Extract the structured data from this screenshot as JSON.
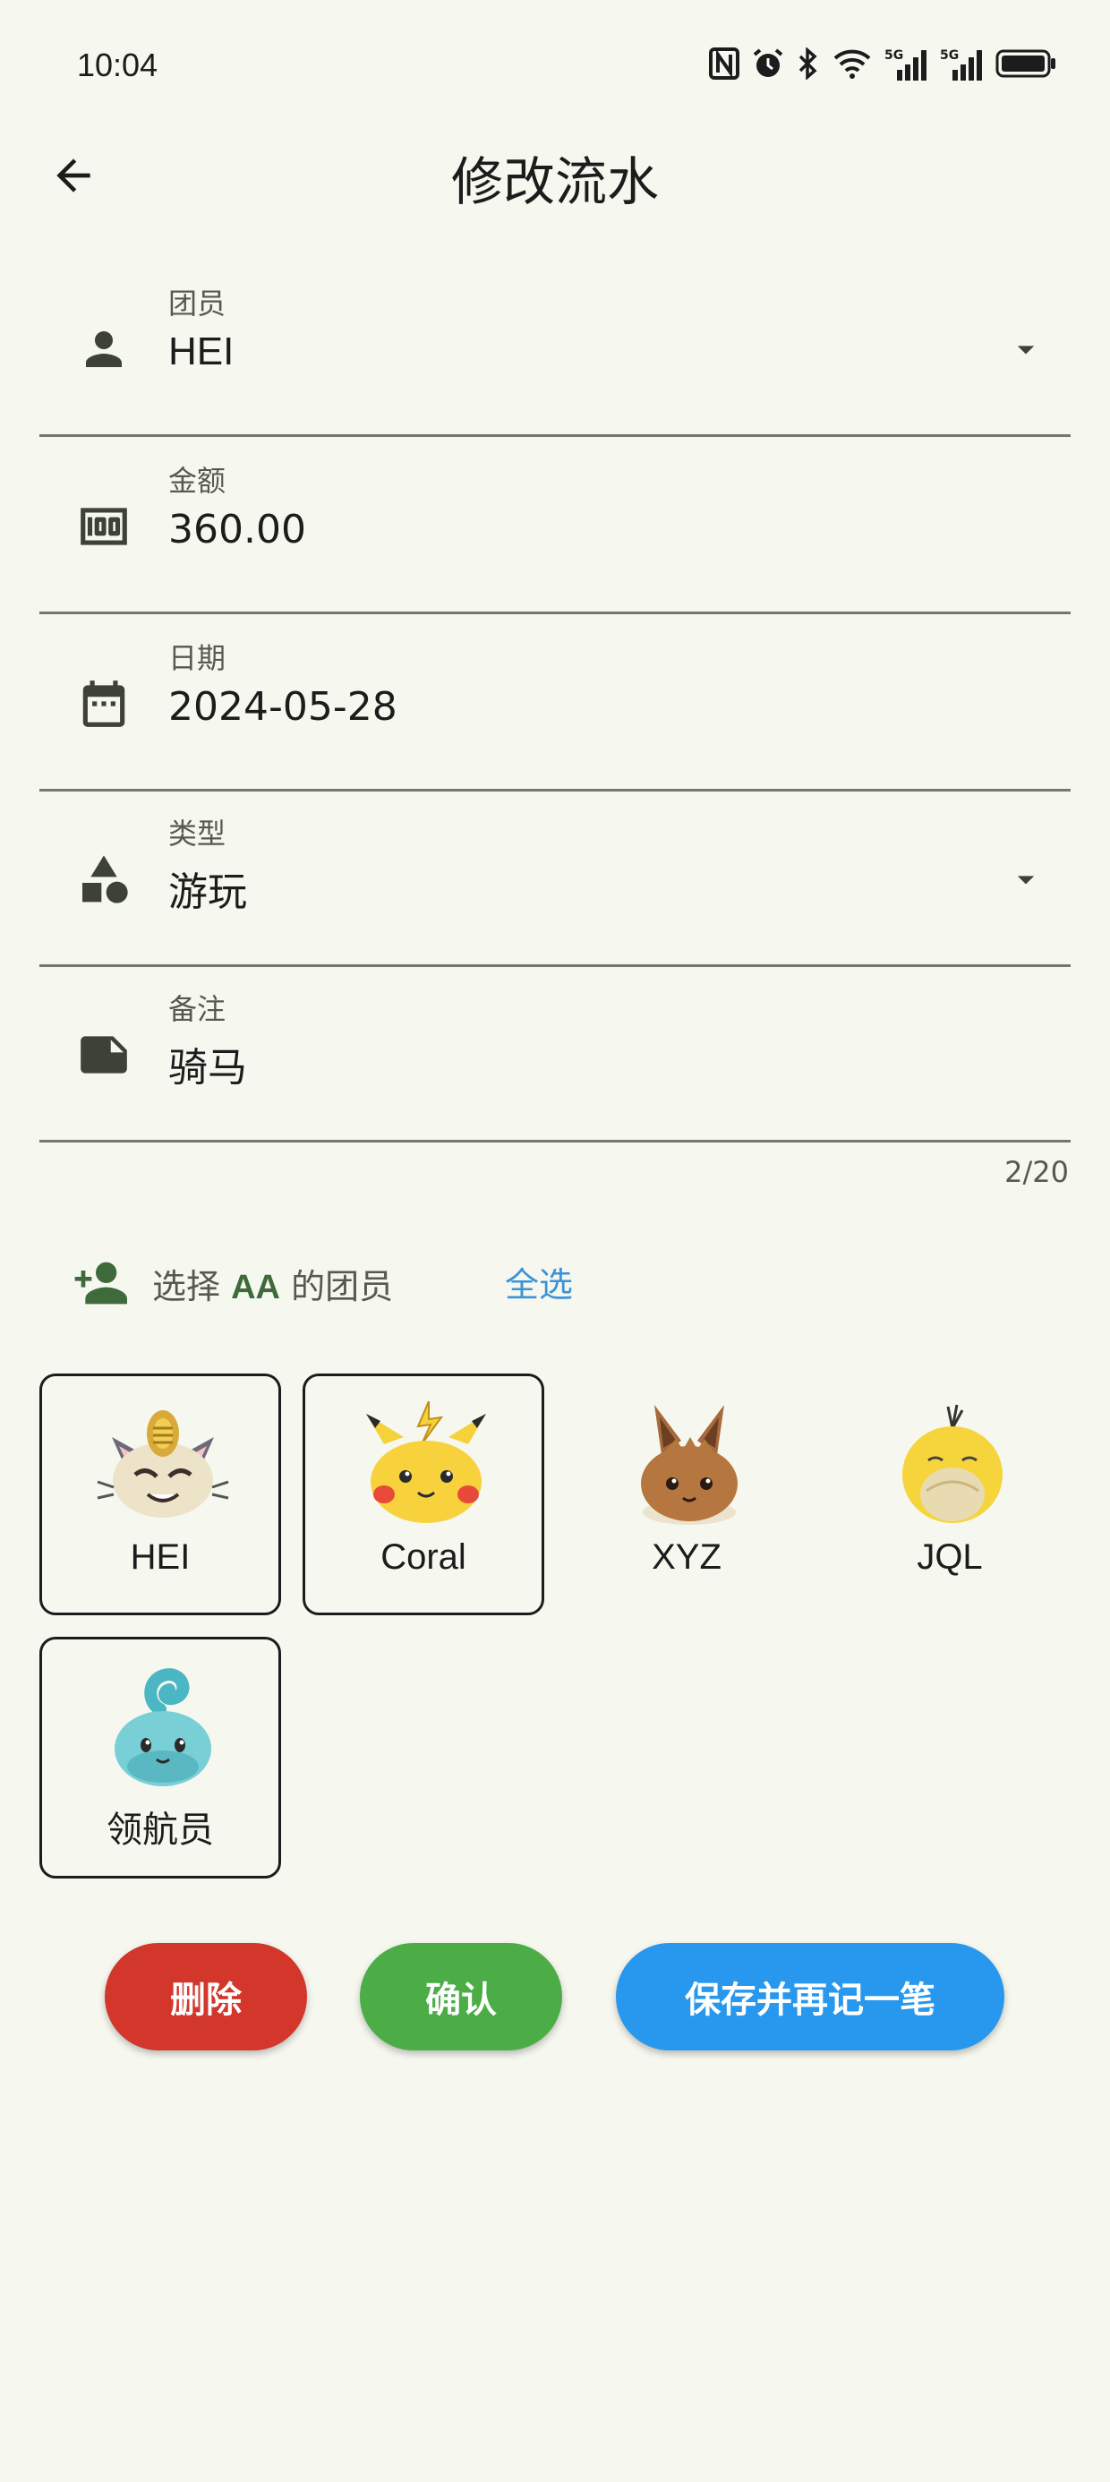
{
  "status": {
    "time": "10:04"
  },
  "app_bar": {
    "title": "修改流水"
  },
  "form": {
    "member": {
      "label": "团员",
      "value": "HEI"
    },
    "amount": {
      "label": "金额",
      "value": "360.00"
    },
    "date": {
      "label": "日期",
      "value": "2024-05-28"
    },
    "type": {
      "label": "类型",
      "value": "游玩"
    },
    "note": {
      "label": "备注",
      "value": "骑马",
      "counter": "2/20"
    }
  },
  "aa_select": {
    "prefix": "选择",
    "highlight": "AA",
    "suffix": "的团员",
    "select_all": "全选"
  },
  "members": [
    {
      "name": "HEI",
      "avatar": "meowth-avatar",
      "selected": true
    },
    {
      "name": "Coral",
      "avatar": "pikachu-avatar",
      "selected": true
    },
    {
      "name": "XYZ",
      "avatar": "eevee-avatar",
      "selected": false
    },
    {
      "name": "JQL",
      "avatar": "psyduck-avatar",
      "selected": false
    },
    {
      "name": "领航员",
      "avatar": "squirtle-avatar",
      "selected": true
    }
  ],
  "buttons": {
    "delete": "删除",
    "confirm": "确认",
    "save_and_new": "保存并再记一笔"
  },
  "colors": {
    "background": "#f6f8f0",
    "delete": "#d3362b",
    "confirm": "#4cad47",
    "save": "#2897ee",
    "link": "#3d93d8",
    "accent_green": "#3f6a3a"
  }
}
